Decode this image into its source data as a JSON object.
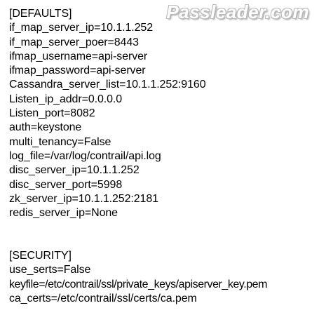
{
  "watermark": "Passleader.com",
  "defaults_section": {
    "header": "[DEFAULTS]",
    "lines": [
      "if_map_server_ip=10.1.1.252",
      "if_map_server_poer=8443",
      "ifmap_username=api-server",
      "ifmap_password=api-server",
      "Cassandra_server_list=10.1.1.252:9160",
      "Listen_ip_addr=0.0.0.0",
      "Listen_port=8082",
      "auth=keystone",
      "multi_tenancy=False",
      "log_file=/var/log/contrail/api.log",
      "disc_server_ip=10.1.1.252",
      "disc_server_port=5998",
      "zk_server_ip=10.1.1.252:2181",
      "redis_server_ip=None"
    ]
  },
  "security_section": {
    "header": "[SECURITY]",
    "lines": [
      "use_serts=False",
      "keyfile=/etc/contrail/ssl/private_keys/apiserver_key.pem",
      "ca_certs=/etc/contrail/ssl/certs/ca.pem"
    ]
  }
}
